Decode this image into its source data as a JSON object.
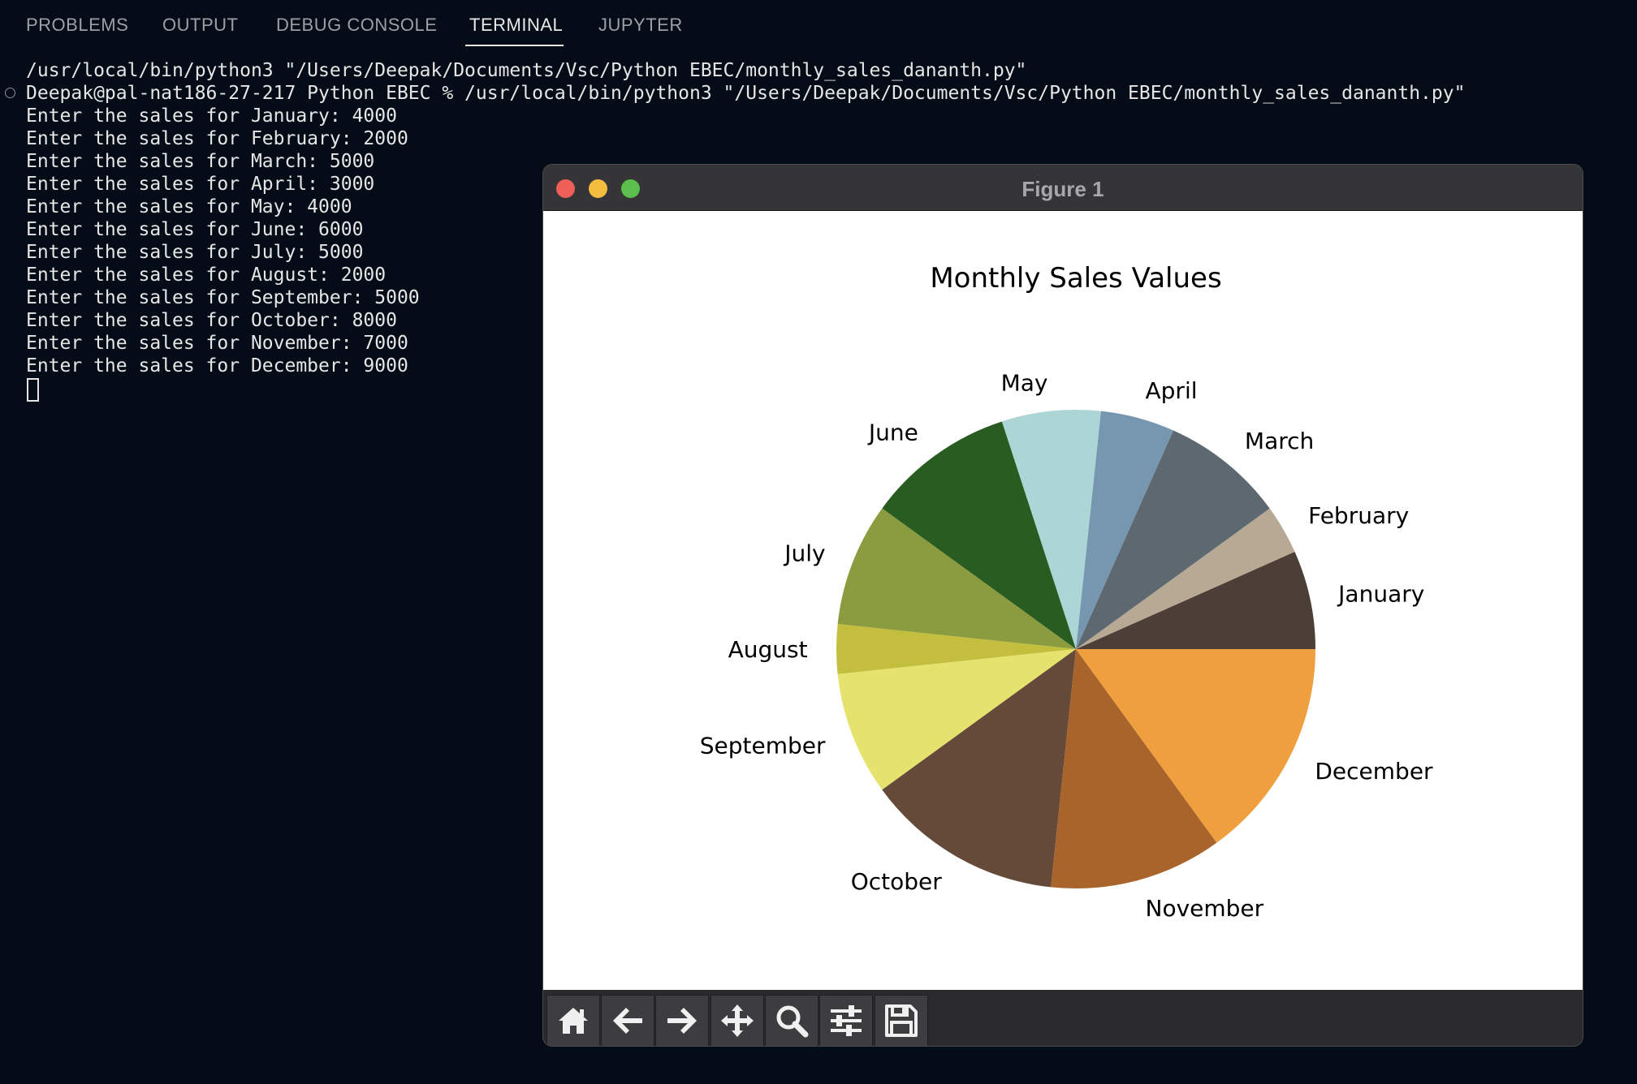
{
  "tabs": [
    {
      "label": "PROBLEMS"
    },
    {
      "label": "OUTPUT"
    },
    {
      "label": "DEBUG CONSOLE"
    },
    {
      "label": "TERMINAL"
    },
    {
      "label": "JUPYTER"
    }
  ],
  "terminal": {
    "lines": [
      "/usr/local/bin/python3 \"/Users/Deepak/Documents/Vsc/Python EBEC/monthly_sales_dananth.py\"",
      "Deepak@pal-nat186-27-217 Python EBEC % /usr/local/bin/python3 \"/Users/Deepak/Documents/Vsc/Python EBEC/monthly_sales_dananth.py\"",
      "Enter the sales for January: 4000",
      "Enter the sales for February: 2000",
      "Enter the sales for March: 5000",
      "Enter the sales for April: 3000",
      "Enter the sales for May: 4000",
      "Enter the sales for June: 6000",
      "Enter the sales for July: 5000",
      "Enter the sales for August: 2000",
      "Enter the sales for September: 5000",
      "Enter the sales for October: 8000",
      "Enter the sales for November: 7000",
      "Enter the sales for December: 9000"
    ]
  },
  "figure": {
    "window_title": "Figure 1",
    "toolbar": [
      {
        "name": "home-icon"
      },
      {
        "name": "back-arrow-icon"
      },
      {
        "name": "forward-arrow-icon"
      },
      {
        "name": "pan-icon"
      },
      {
        "name": "zoom-icon"
      },
      {
        "name": "subplots-config-icon"
      },
      {
        "name": "save-icon"
      }
    ]
  },
  "chart_data": {
    "type": "pie",
    "title": "Monthly Sales Values",
    "categories": [
      "January",
      "February",
      "March",
      "April",
      "May",
      "June",
      "July",
      "August",
      "September",
      "October",
      "November",
      "December"
    ],
    "values": [
      4000,
      2000,
      5000,
      3000,
      4000,
      6000,
      5000,
      2000,
      5000,
      8000,
      7000,
      9000
    ],
    "colors": [
      "#4b3f38",
      "#b8a994",
      "#5d6870",
      "#7797b0",
      "#acd5d6",
      "#295c20",
      "#8b9c40",
      "#c4be3f",
      "#e5e36e",
      "#654939",
      "#a8642b",
      "#ef9f3e"
    ],
    "start_angle_deg": 0,
    "direction": "counterclockwise"
  }
}
